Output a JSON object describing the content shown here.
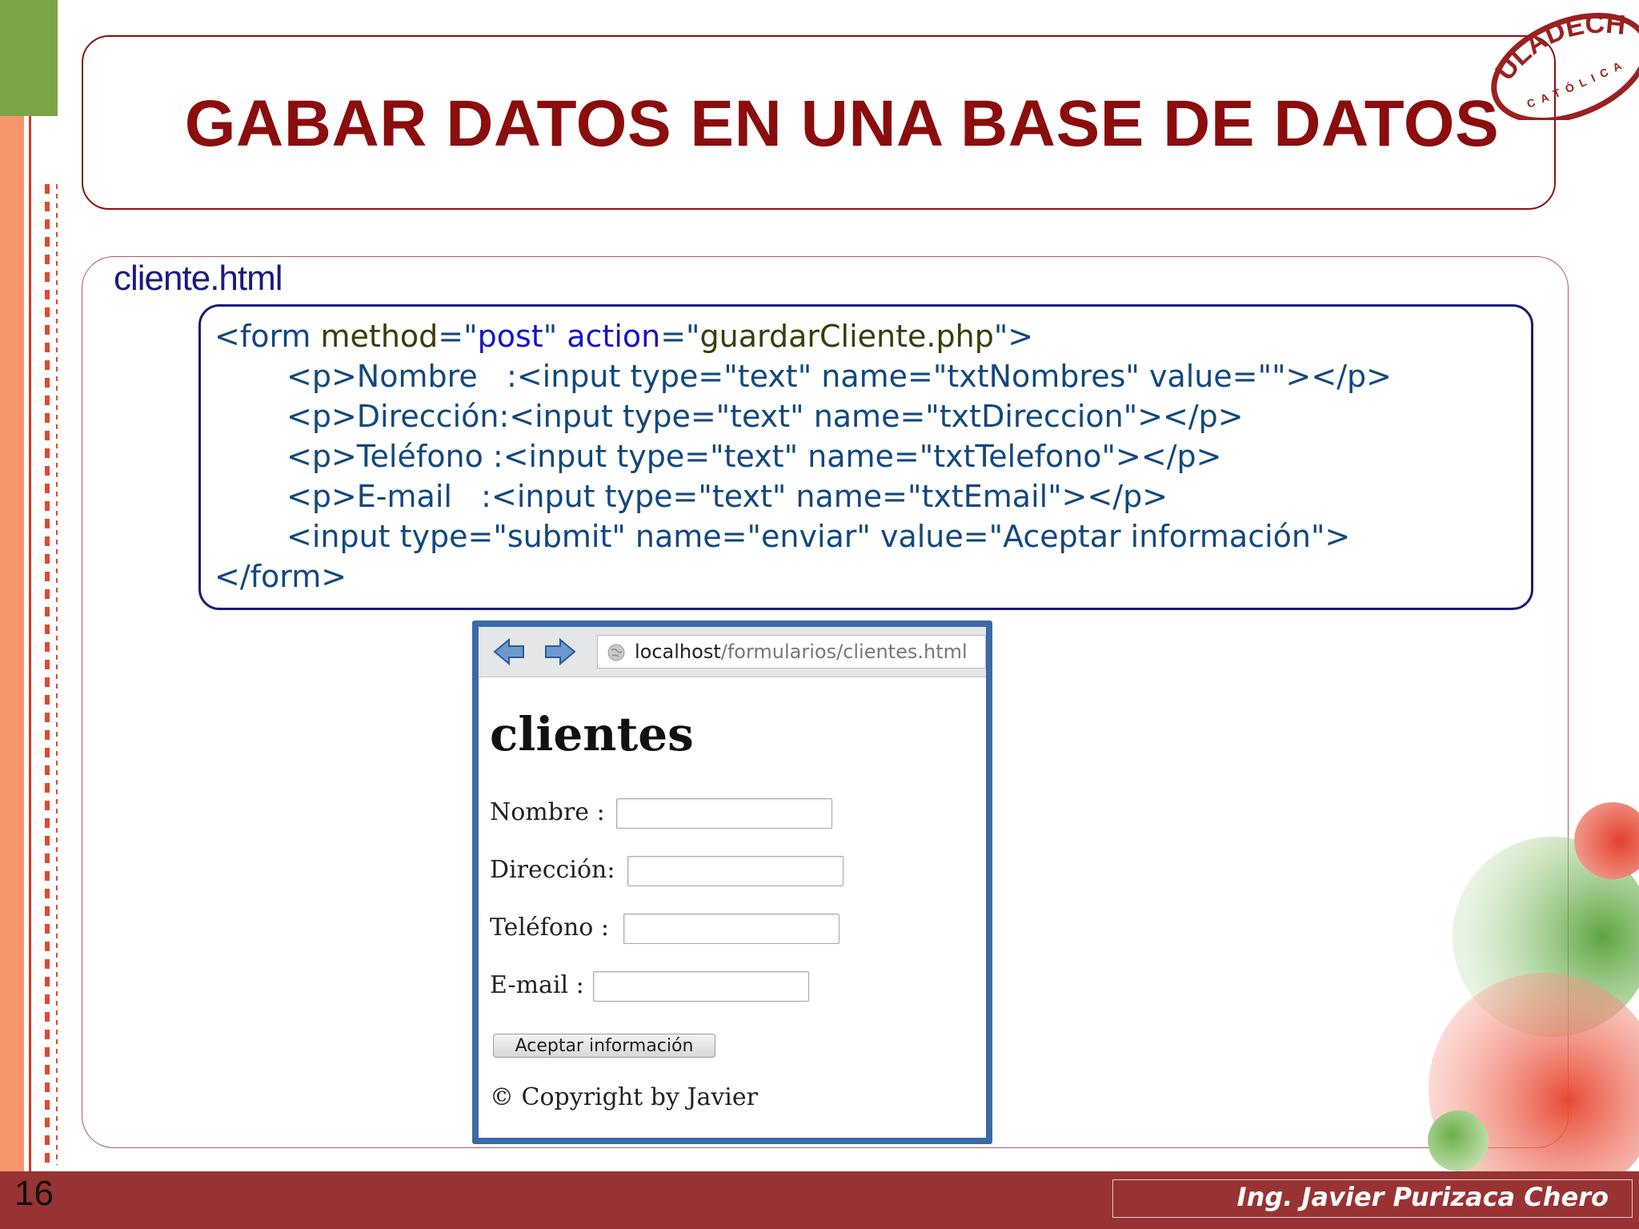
{
  "slide": {
    "title": "GABAR DATOS EN UNA BASE DE DATOS",
    "file_label": "cliente.html",
    "page_number": "16",
    "author": "Ing. Javier Purizaca Chero",
    "logo": {
      "name": "ULADECH",
      "subtitle": "CATÓLICA",
      "color": "#9b2020"
    }
  },
  "code": {
    "line1": {
      "open": "<form ",
      "method_attr": "method",
      "eq1": "=\"",
      "method_val": "post",
      "mid": "\" ",
      "action_attr": "action",
      "eq2": "=\"",
      "action_val": "guardarCliente.php",
      "close": "\">"
    },
    "line2": "<p>Nombre   :<input type=\"text\" name=\"txtNombres\" value=\"\"></p>",
    "line3": "<p>Dirección:<input type=\"text\" name=\"txtDireccion\"></p>",
    "line4": "<p>Teléfono :<input type=\"text\" name=\"txtTelefono\"></p>",
    "line5": "<p>E-mail   :<input type=\"text\" name=\"txtEmail\"></p>",
    "line6": "<input type=\"submit\" name=\"enviar\" value=\"Aceptar información\">",
    "line7": "</form>"
  },
  "browser": {
    "url_host": "localhost",
    "url_path": "/formularios/clientes.html",
    "heading": "clientes",
    "fields": {
      "nombre": "Nombre :",
      "direccion": "Dirección:",
      "telefono": "Teléfono :",
      "email": "E-mail :"
    },
    "submit_label": "Aceptar información",
    "copyright": "© Copyright by Javier"
  },
  "colors": {
    "title": "#8b0d0d",
    "code_text": "#12487e",
    "code_olive": "#3b3c08",
    "code_blue": "#1515c8",
    "footer": "#993333",
    "browser_frame": "#3a6aa8"
  }
}
